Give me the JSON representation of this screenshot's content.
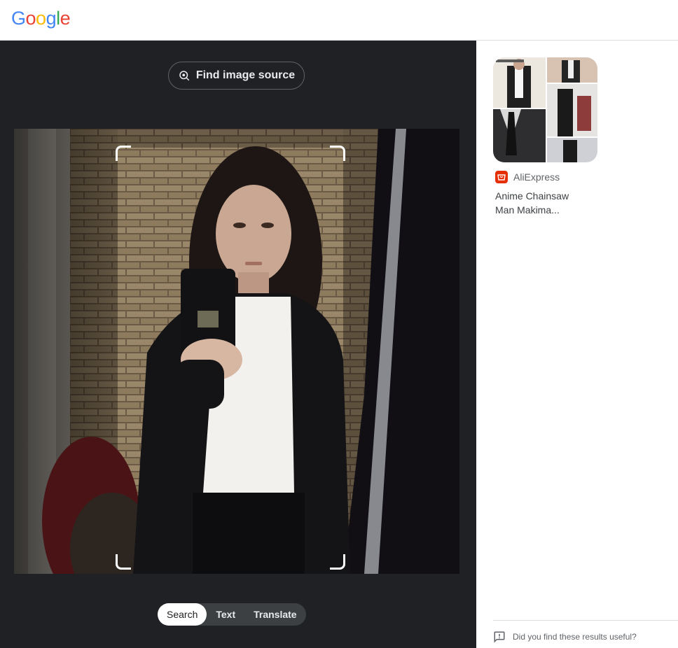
{
  "header": {
    "logo_letters": [
      {
        "ch": "G",
        "color": "#4285F4"
      },
      {
        "ch": "o",
        "color": "#EA4335"
      },
      {
        "ch": "o",
        "color": "#FBBC05"
      },
      {
        "ch": "g",
        "color": "#4285F4"
      },
      {
        "ch": "l",
        "color": "#34A853"
      },
      {
        "ch": "e",
        "color": "#EA4335"
      }
    ]
  },
  "lens": {
    "find_source_label": "Find image source",
    "find_source_icon": "image-search-icon",
    "modes": [
      {
        "label": "Search",
        "active": true
      },
      {
        "label": "Text",
        "active": false
      },
      {
        "label": "Translate",
        "active": false
      }
    ]
  },
  "results": [
    {
      "source": "AliExpress",
      "source_icon": "aliexpress-cart-icon",
      "title": "Anime Chainsaw Man Makima..."
    }
  ],
  "feedback": {
    "icon": "feedback-icon",
    "label": "Did you find these results useful?"
  },
  "colors": {
    "panel_dark": "#202124",
    "brand_aliexpress": "#E62E04"
  }
}
